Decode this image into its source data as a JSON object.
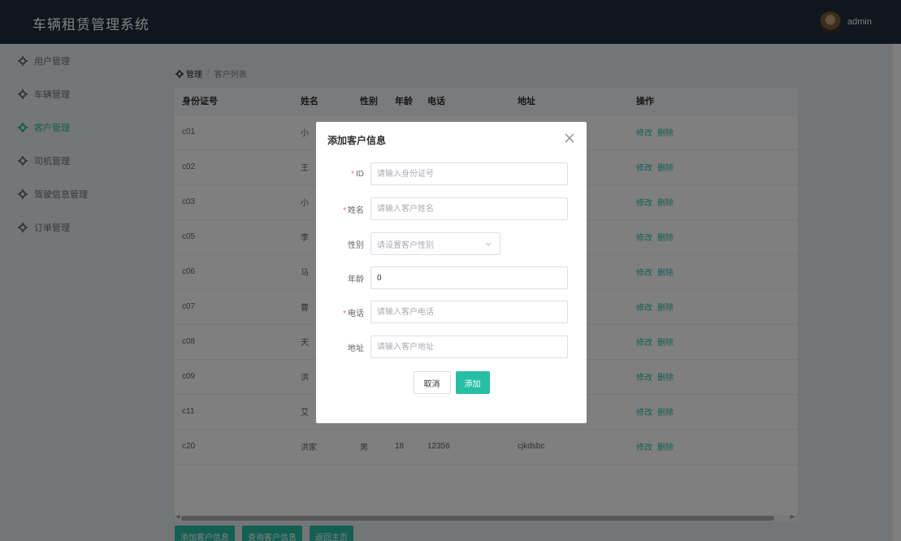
{
  "header": {
    "title": "车辆租赁管理系统",
    "username": "admin"
  },
  "sidebar": {
    "items": [
      {
        "label": "用户管理"
      },
      {
        "label": "车辆管理"
      },
      {
        "label": "客户管理",
        "active": true
      },
      {
        "label": "司机管理"
      },
      {
        "label": "驾驶信息管理"
      },
      {
        "label": "订单管理"
      }
    ]
  },
  "breadcrumb": {
    "root": "管理",
    "separator": "/",
    "current": "客户列表"
  },
  "table": {
    "columns": [
      "身份证号",
      "姓名",
      "性别",
      "年龄",
      "电话",
      "地址",
      "操作"
    ],
    "rows": [
      {
        "id": "c01",
        "name": "小",
        "gender": "",
        "age": "",
        "phone": "",
        "address": ""
      },
      {
        "id": "c02",
        "name": "王",
        "gender": "",
        "age": "",
        "phone": "",
        "address": ""
      },
      {
        "id": "c03",
        "name": "小",
        "gender": "",
        "age": "",
        "phone": "",
        "address": ""
      },
      {
        "id": "c05",
        "name": "李",
        "gender": "",
        "age": "",
        "phone": "",
        "address": ""
      },
      {
        "id": "c06",
        "name": "马",
        "gender": "",
        "age": "",
        "phone": "",
        "address": ""
      },
      {
        "id": "c07",
        "name": "曹",
        "gender": "",
        "age": "",
        "phone": "",
        "address": ""
      },
      {
        "id": "c08",
        "name": "天",
        "gender": "",
        "age": "",
        "phone": "",
        "address": ""
      },
      {
        "id": "c09",
        "name": "洪",
        "gender": "",
        "age": "",
        "phone": "",
        "address": ""
      },
      {
        "id": "c11",
        "name": "艾",
        "gender": "",
        "age": "",
        "phone": "",
        "address": ""
      },
      {
        "id": "c20",
        "name": "洪家",
        "gender": "男",
        "age": "18",
        "phone": "12356",
        "address": "cjkdsbc"
      }
    ],
    "edit_label": "修改",
    "delete_label": "删除"
  },
  "actions": {
    "add": "添加客户信息",
    "query": "查询客户信息",
    "home": "返回主页"
  },
  "dialog": {
    "title": "添加客户信息",
    "fields": {
      "id": {
        "label": "ID",
        "placeholder": "请输入身份证号",
        "required": true
      },
      "name": {
        "label": "姓名",
        "placeholder": "请输入客户姓名",
        "required": true
      },
      "gender": {
        "label": "性别",
        "placeholder": "请设置客户性别"
      },
      "age": {
        "label": "年龄",
        "value": "0"
      },
      "phone": {
        "label": "电话",
        "placeholder": "请输入客户电话",
        "required": true
      },
      "address": {
        "label": "地址",
        "placeholder": "请输入客户地址"
      }
    },
    "cancel": "取消",
    "submit": "添加"
  },
  "colors": {
    "accent": "#26bfa5",
    "header_bg": "#1f2d3d",
    "sidebar_bg": "#e9ecef"
  }
}
